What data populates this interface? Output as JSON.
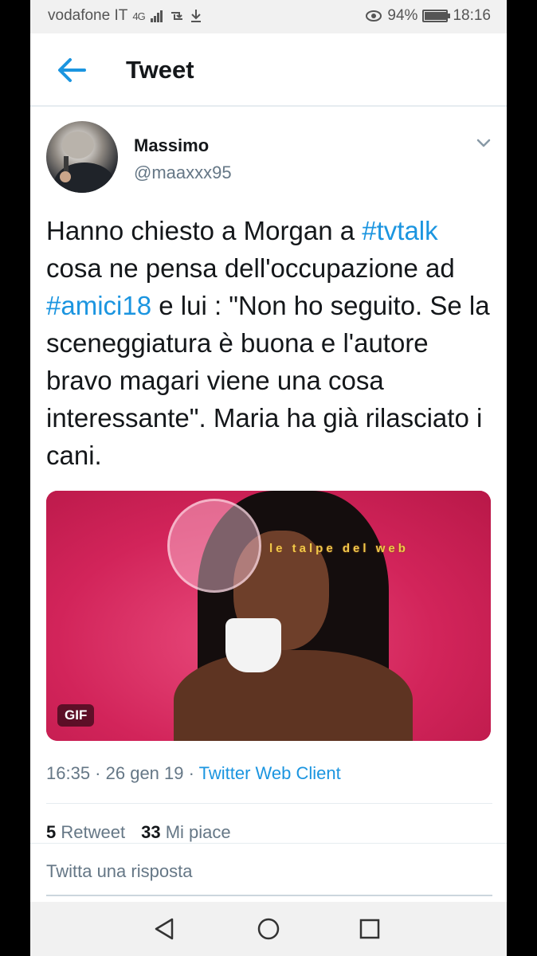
{
  "status_bar": {
    "carrier": "vodafone IT",
    "network": "4G",
    "battery": "94%",
    "battery_level": 0.94,
    "time": "18:16"
  },
  "header": {
    "title": "Tweet"
  },
  "tweet": {
    "author_name": "Massimo",
    "author_handle": "@maaxxx95",
    "text_parts": {
      "p1": "Hanno chiesto a Morgan a ",
      "tag1": "#tvtalk",
      "p2": " cosa ne pensa dell'occupazione ad ",
      "tag2": "#amici18",
      "p3": " e lui : \"Non ho seguito. Se la sceneggiatura è buona e l'autore bravo magari viene una cosa interessante\". Maria ha già rilasciato i cani."
    },
    "media_badge": "GIF",
    "watermark": "le talpe del web",
    "time": "16:35",
    "date": "26 gen 19",
    "client": "Twitter Web Client",
    "separator": " · ",
    "retweets_count": "5",
    "retweets_label": "Retweet",
    "likes_count": "33",
    "likes_label": "Mi piace"
  },
  "reply": {
    "placeholder": "Twitta una risposta"
  },
  "colors": {
    "link": "#1b95e0",
    "secondary_text": "#657786",
    "media_bg": "#d6265c"
  },
  "icons": {
    "back": "arrow-left-icon",
    "menu": "chevron-down-icon",
    "nav_back": "triangle-back-icon",
    "nav_home": "circle-home-icon",
    "nav_recents": "square-recents-icon"
  }
}
